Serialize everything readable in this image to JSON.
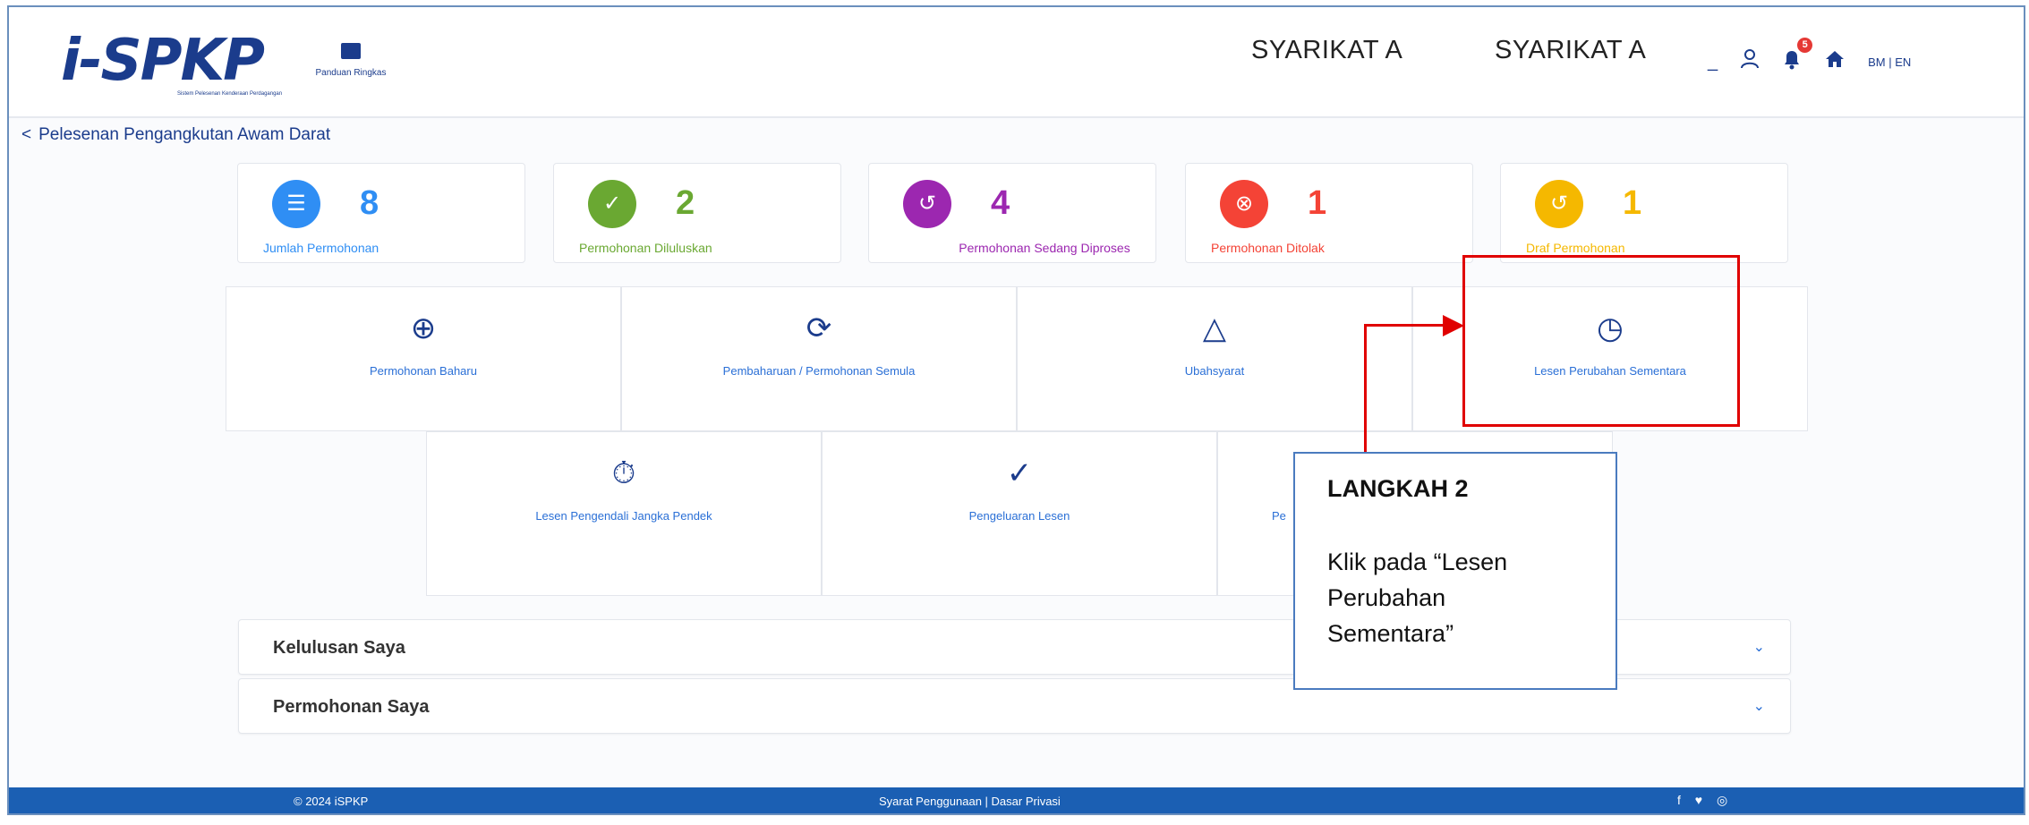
{
  "header": {
    "logo_text": "i-SPKP",
    "logo_tagline": "Sistem Pelesenan Kenderaan Perdagangan",
    "guide_label": "Panduan Ringkas",
    "user_label_1": "SYARIKAT A",
    "user_label_2": "SYARIKAT A",
    "minimize_glyph": "_",
    "user_icon": "user-icon",
    "notification_count": "5",
    "home_icon": "home-icon",
    "lang_bm": "BM",
    "lang_sep": "|",
    "lang_en": "EN"
  },
  "breadcrumb": {
    "chevron": "<",
    "label": "Pelesenan Pengangkutan Awam Darat"
  },
  "stats": [
    {
      "count": "8",
      "label": "Jumlah Permohonan",
      "color": "#2f8ef4",
      "glyph": "☰"
    },
    {
      "count": "2",
      "label": "Permohonan Diluluskan",
      "color": "#6aa832",
      "glyph": "✓"
    },
    {
      "count": "4",
      "label": "Permohonan Sedang Diproses",
      "color": "#9c27b0",
      "glyph": "↺"
    },
    {
      "count": "1",
      "label": "Permohonan Ditolak",
      "color": "#f44336",
      "glyph": "⊗"
    },
    {
      "count": "1",
      "label": "Draf Permohonan",
      "color": "#f5b800",
      "glyph": "↺"
    }
  ],
  "menu": [
    {
      "label": "Permohonan Baharu",
      "glyph": "⊕",
      "icon": "add-circle-icon"
    },
    {
      "label": "Pembaharuan / Permohonan Semula",
      "glyph": "⟳",
      "icon": "renew-icon"
    },
    {
      "label": "Ubahsyarat",
      "glyph": "△",
      "icon": "triangle-icon"
    },
    {
      "label": "Lesen Perubahan Sementara",
      "glyph": "◷",
      "icon": "clock-icon"
    },
    {
      "label": "Lesen Pengendali Jangka Pendek",
      "glyph": "⏱",
      "icon": "stopwatch-icon"
    },
    {
      "label": "Pengeluaran Lesen",
      "glyph": "✓",
      "icon": "check-icon"
    },
    {
      "label": "Pe",
      "glyph": "",
      "icon": "partial-icon"
    }
  ],
  "accordions": [
    {
      "title": "Kelulusan Saya",
      "chevron": "⌄"
    },
    {
      "title": "Permohonan Saya",
      "chevron": "⌄"
    }
  ],
  "footer": {
    "copyright": "© 2024 iSPKP",
    "links": "Syarat Penggunaan | Dasar Privasi",
    "social": "f ♥ ◎"
  },
  "annotation": {
    "title": "LANGKAH 2",
    "body": "Klik pada “Lesen\nPerubahan\nSementara”",
    "color": "#e00000"
  }
}
